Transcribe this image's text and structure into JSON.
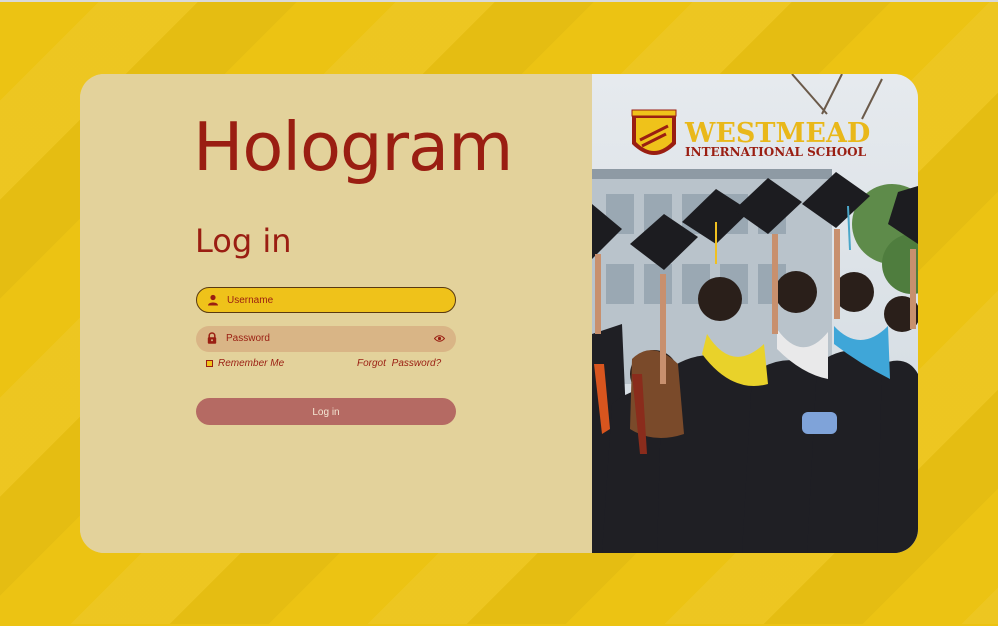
{
  "brand": {
    "title": "Hologram"
  },
  "login": {
    "heading": "Log in",
    "username_placeholder": "Username",
    "password_placeholder": "Password",
    "remember_label": "Remember Me",
    "forgot_label": "Forgot  Password?",
    "submit_label": "Log in"
  },
  "school": {
    "name_line1": "WESTMEAD",
    "name_line2": "INTERNATIONAL SCHOOL"
  },
  "colors": {
    "background": "#ecc313",
    "panel": "#e3d29b",
    "accent": "#9a1e12",
    "button": "#b56a63",
    "username_field": "#efc21a",
    "password_field": "#d9b586"
  },
  "icons": {
    "username": "user-icon",
    "password": "lock-icon",
    "reveal": "eye-icon"
  }
}
